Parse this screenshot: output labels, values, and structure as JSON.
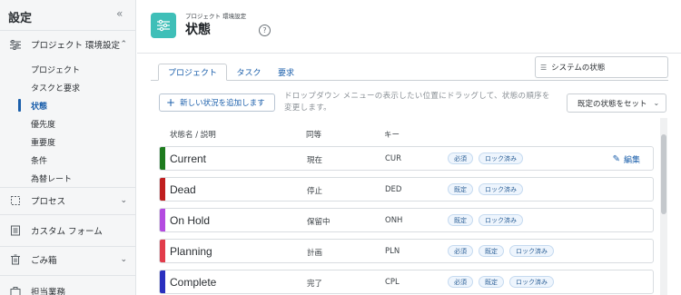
{
  "sidebar": {
    "title": "設定",
    "collapse_icon": "double-chevron-left-icon",
    "sections": [
      {
        "label": "プロジェクト 環境設定",
        "icon": "sliders-icon",
        "expanded": true
      },
      {
        "label": "プロセス",
        "icon": "process-icon",
        "expanded": false
      },
      {
        "label": "カスタム フォーム",
        "icon": "form-icon",
        "expanded": false
      },
      {
        "label": "ごみ箱",
        "icon": "trash-icon",
        "expanded": false
      },
      {
        "label": "担当業務",
        "icon": "briefcase-icon",
        "expanded": false
      }
    ],
    "subitems": [
      "プロジェクト",
      "タスクと要求",
      "状態",
      "優先度",
      "重要度",
      "条件",
      "為替レート"
    ],
    "active_subitem": "状態"
  },
  "header": {
    "breadcrumb": "プロジェクト 環境設定",
    "title": "状態",
    "icon": "sliders-icon",
    "help_label": "?"
  },
  "tabs": [
    {
      "label": "プロジェクト",
      "active": true
    },
    {
      "label": "タスク",
      "active": false
    },
    {
      "label": "要求",
      "active": false
    }
  ],
  "search": {
    "icon": "status-filter-icon",
    "value": "システムの状態"
  },
  "toolbar": {
    "add_label": "新しい状況を追加します",
    "hint": "ドロップダウン メニューの表示したい位置にドラッグして、状態の順序を変更します。",
    "default_label": "既定の状態をセット"
  },
  "table": {
    "headers": {
      "name": "状態名 / 説明",
      "equiv": "同等",
      "key": "キー"
    },
    "rows": [
      {
        "name": "Current",
        "equiv": "現在",
        "key": "CUR",
        "color": "#1e7b1e",
        "badges": [
          "必須",
          "ロック済み"
        ],
        "edit": "編集"
      },
      {
        "name": "Dead",
        "equiv": "停止",
        "key": "DED",
        "color": "#c01f1f",
        "badges": [
          "既定",
          "ロック済み"
        ],
        "edit": ""
      },
      {
        "name": "On Hold",
        "equiv": "保留中",
        "key": "ONH",
        "color": "#b44be0",
        "badges": [
          "既定",
          "ロック済み"
        ],
        "edit": ""
      },
      {
        "name": "Planning",
        "equiv": "計画",
        "key": "PLN",
        "color": "#e23c4b",
        "badges": [
          "必須",
          "既定",
          "ロック済み"
        ],
        "edit": ""
      },
      {
        "name": "Complete",
        "equiv": "完了",
        "key": "CPL",
        "color": "#2a2fbf",
        "badges": [
          "必須",
          "既定",
          "ロック済み"
        ],
        "edit": ""
      }
    ]
  },
  "colors": {
    "accent": "#1b5fab",
    "header_icon_bg": "#3fbfb8"
  }
}
